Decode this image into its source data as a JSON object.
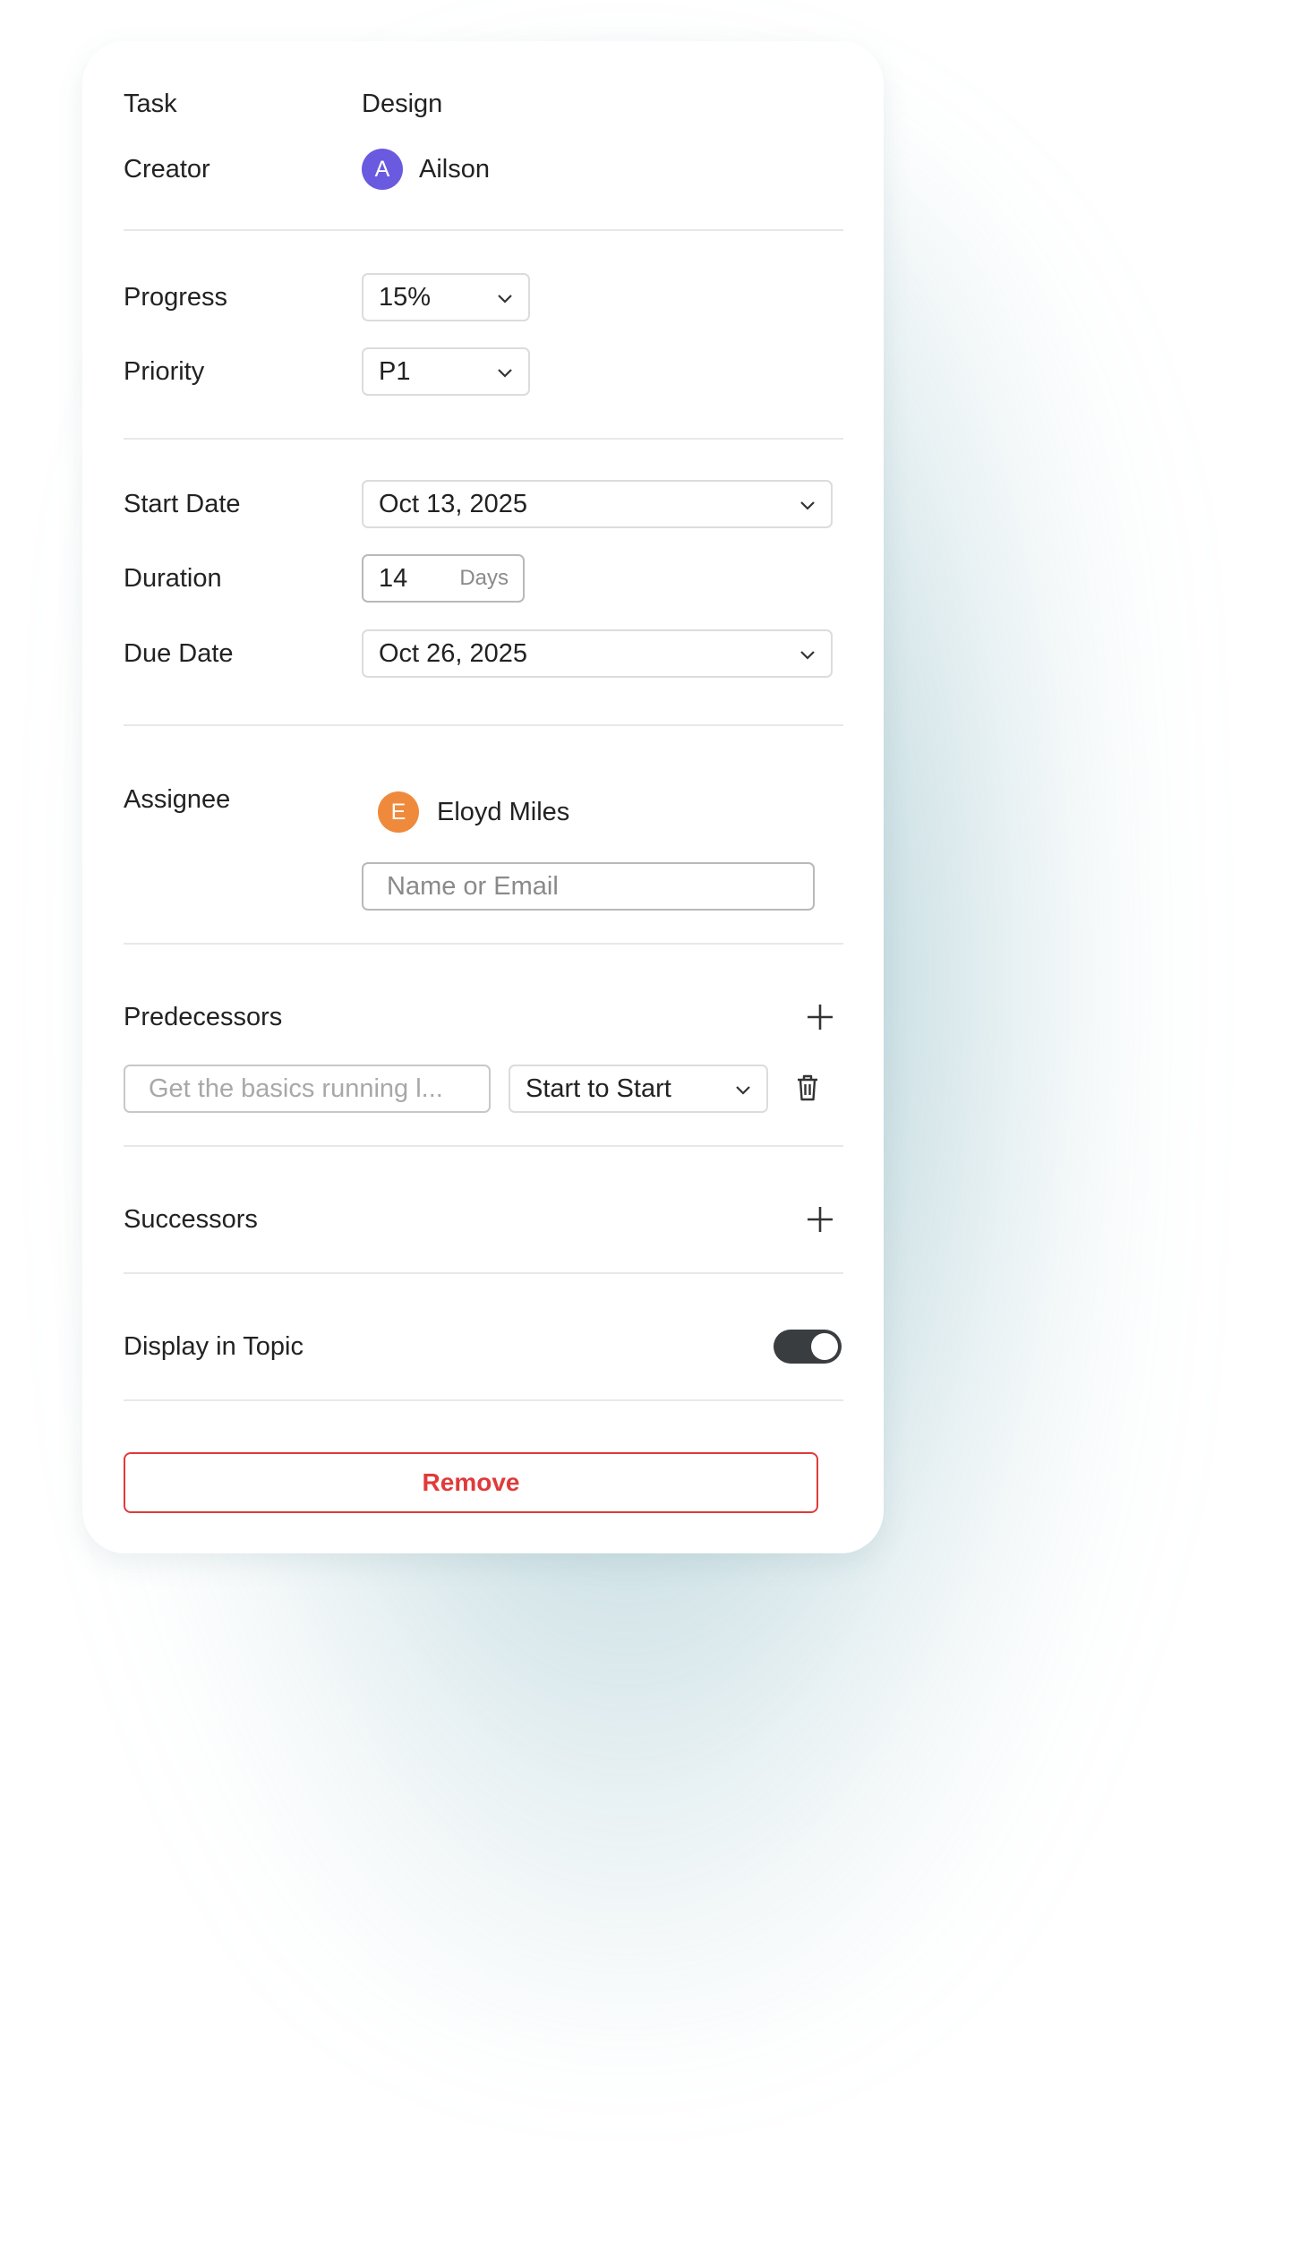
{
  "task": {
    "label": "Task",
    "value": "Design"
  },
  "creator": {
    "label": "Creator",
    "initial": "A",
    "name": "Ailson",
    "avatar_color": "#6a5ae0"
  },
  "progress": {
    "label": "Progress",
    "value": "15%"
  },
  "priority": {
    "label": "Priority",
    "value": "P1"
  },
  "start_date": {
    "label": "Start Date",
    "value": "Oct 13, 2025"
  },
  "duration": {
    "label": "Duration",
    "value": "14",
    "unit": "Days"
  },
  "due_date": {
    "label": "Due Date",
    "value": "Oct 26, 2025"
  },
  "assignee": {
    "label": "Assignee",
    "initial": "E",
    "name": "Eloyd Miles",
    "avatar_color": "#ef8a3c",
    "input_placeholder": "Name or Email"
  },
  "predecessors": {
    "label": "Predecessors",
    "item_placeholder": "Get the basics running l...",
    "relation": "Start to Start"
  },
  "successors": {
    "label": "Successors"
  },
  "display_in_topic": {
    "label": "Display in Topic",
    "enabled": true
  },
  "remove_label": "Remove",
  "colors": {
    "danger": "#e03a3a",
    "toggle_on": "#3a3d40"
  }
}
